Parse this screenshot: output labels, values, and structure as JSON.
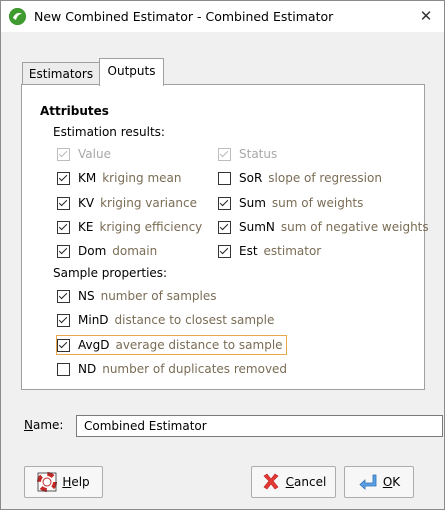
{
  "window": {
    "title": "New Combined Estimator - Combined Estimator",
    "close_glyph": "✕"
  },
  "tabs": [
    {
      "label": "Estimators"
    },
    {
      "label": "Outputs"
    }
  ],
  "outputs": {
    "heading": "Attributes",
    "estimation_results_label": "Estimation results:",
    "estimation_left": [
      {
        "abbr": "",
        "label": "Value",
        "desc": "",
        "checked": true,
        "disabled": true
      },
      {
        "abbr": "KM",
        "label": "",
        "desc": "kriging mean",
        "checked": true,
        "disabled": false
      },
      {
        "abbr": "KV",
        "label": "",
        "desc": "kriging variance",
        "checked": true,
        "disabled": false
      },
      {
        "abbr": "KE",
        "label": "",
        "desc": "kriging efficiency",
        "checked": true,
        "disabled": false
      },
      {
        "abbr": "Dom",
        "label": "",
        "desc": "domain",
        "checked": true,
        "disabled": false
      }
    ],
    "estimation_right": [
      {
        "abbr": "",
        "label": "Status",
        "desc": "",
        "checked": true,
        "disabled": true
      },
      {
        "abbr": "SoR",
        "label": "",
        "desc": "slope of regression",
        "checked": false,
        "disabled": false
      },
      {
        "abbr": "Sum",
        "label": "",
        "desc": "sum of weights",
        "checked": true,
        "disabled": false
      },
      {
        "abbr": "SumN",
        "label": "",
        "desc": "sum of negative weights",
        "checked": true,
        "disabled": false
      },
      {
        "abbr": "Est",
        "label": "",
        "desc": "estimator",
        "checked": true,
        "disabled": false
      }
    ],
    "sample_properties_label": "Sample properties:",
    "sample_properties": [
      {
        "abbr": "NS",
        "desc": "number of samples",
        "checked": true
      },
      {
        "abbr": "MinD",
        "desc": "distance to closest sample",
        "checked": true
      },
      {
        "abbr": "AvgD",
        "desc": "average distance to sample",
        "checked": true
      },
      {
        "abbr": "ND",
        "desc": "number of duplicates removed",
        "checked": false
      }
    ]
  },
  "name_field": {
    "label_first": "N",
    "label_rest": "ame:",
    "value": "Combined Estimator"
  },
  "buttons": {
    "help": {
      "first": "H",
      "rest": "elp"
    },
    "cancel": {
      "first": "C",
      "rest": "ancel"
    },
    "ok": {
      "first": "O",
      "rest": "K"
    }
  },
  "colors": {
    "accent_focus": "#e9a84c",
    "description_text": "#7a6c55",
    "app_icon": "#3f9a2f"
  }
}
